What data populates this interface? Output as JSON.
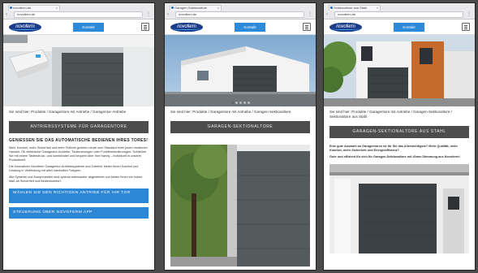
{
  "phones": [
    {
      "tab_title": "novoferm.de",
      "url": "novoferm.de",
      "brand": "novoferm",
      "cta": "Kontakt",
      "crumb": "Sie sind hier: Produkte / Garagentore mit Antriebe / Garagentor-Antriebe",
      "bar_label": "ANTRIEBSSYSTEME FÜR GARAGENTORE",
      "heading": "GENIESSEN SIE DAS AUTOMATISCHE BEDIENEN IHRES TORES!",
      "paragraphs": [
        "Mehr Komfort, mehr Sicherheit und mehr Freiheit gehören heute zum Standard einer jeden modernen Haustür. Ob elektrische Garagentor-Antriebe, Torsteuerungen oder Funkfernbedienungen: Schließen Sie mit einem Tastendruck, und komfortabel und bequem über Ihre Handy – individuell in unserer Produktwelt.",
        "Die innovativen Novoferm Garagentor-Antriebssysteme und Zubehör bieten Ihnen Komfort und Leistung in Verbindung mit allen namhaften Tortypen.",
        "Alle Systeme und Komponenten sind optimal aufeinander abgestimmt und bieten Ihnen ein hohes Maß an Sicherheit und Bedienkomfort."
      ],
      "buttons": [
        "WÄHLEN SIE DEN RICHTIGEN ANTRIEB FÜR IHR TOR",
        "STEUERUNG ÜBER NOVOFERM APP"
      ]
    },
    {
      "tab_title": "Garagen-Sektionaltore",
      "url": "novoferm.de",
      "brand": "novoferm",
      "cta": "Kontakt",
      "crumb": "Sie sind hier: Produkte / Garagentore mit Antriebe / Garagen-Sektionaltore",
      "bar_label": "GARAGEN-SEKTIONALTORE"
    },
    {
      "tab_title": "Sektionaltore aus Stahl",
      "url": "novoferm.de",
      "brand": "novoferm",
      "cta": "Kontakt",
      "crumb": "Sie sind hier: Produkte / Garagentore mit Antriebe / Garagen-Sektionaltore / Sektionaltore aus Stahl",
      "bar_label": "GARAGEN-SEKTIONALTORE AUS STAHL",
      "intro": "Eine gute Auswahl an Garagentoren ist für Sie das Allerwichtigste? Mehr Qualität, mehr Komfort, mehr Sicherheit und Energieeffizienz?",
      "intro2": "Gute und effizient für sich für Garagen-Sektionaltore mit 40mm Dämmung aus Novoferm!"
    }
  ],
  "colors": {
    "accent_blue": "#2c88d6",
    "brand_navy": "#1b3c8a",
    "bar_gray": "#4d4d4d"
  }
}
